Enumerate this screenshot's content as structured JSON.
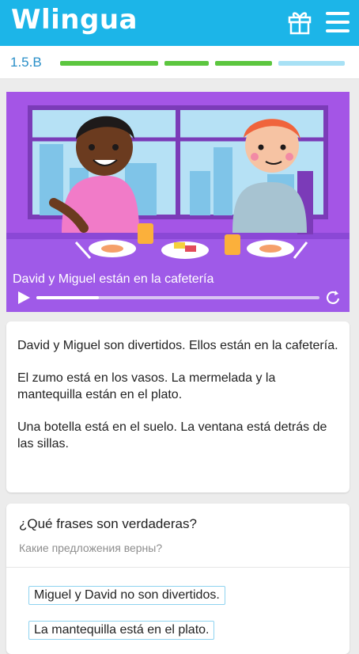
{
  "app": {
    "logo": "Wlingua"
  },
  "lesson": {
    "code": "1.5.B",
    "segments": [
      {
        "color": "#5cc63f"
      },
      {
        "color": "#5cc63f"
      },
      {
        "color": "#5cc63f"
      },
      {
        "color": "#a8e1f5"
      }
    ]
  },
  "video": {
    "caption": "David y Miguel están en la cafetería",
    "progress_percent": 22
  },
  "reading": {
    "paragraphs": [
      "David y Miguel son divertidos. Ellos están en la cafetería.",
      "El zumo está en los vasos. La mermelada y la mantequilla están en el plato.",
      "Una botella está en el suelo. La ventana está detrás de las sillas."
    ]
  },
  "question": {
    "title": "¿Qué frases son verdaderas?",
    "subtitle": "Какие предложения верны?",
    "options": [
      "Miguel y David no son divertidos.",
      "La mantequilla está en el plato."
    ]
  },
  "colors": {
    "brand": "#1cb5e8",
    "progress_done": "#5cc63f",
    "progress_todo": "#a8e1f5",
    "video_bg": "#a455e6"
  },
  "icons": {
    "gift": "gift-icon",
    "menu": "hamburger-menu-icon",
    "play": "play-icon",
    "replay": "replay-icon"
  }
}
